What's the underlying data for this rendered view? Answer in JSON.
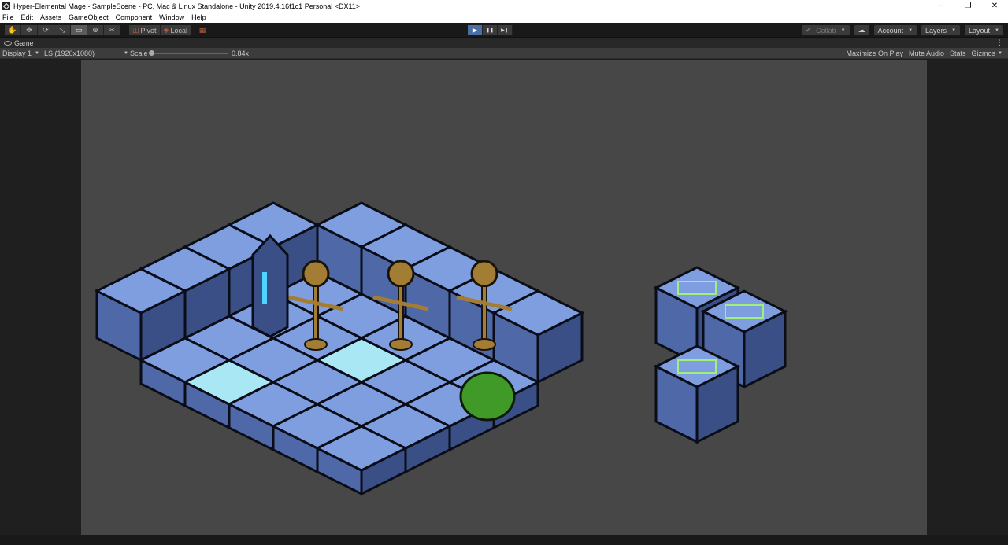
{
  "window": {
    "title": "Hyper-Elemental Mage - SampleScene - PC, Mac & Linux Standalone - Unity 2019.4.16f1c1 Personal <DX11>",
    "controls": [
      "–",
      "❐",
      "✕"
    ]
  },
  "menu": [
    "File",
    "Edit",
    "Assets",
    "GameObject",
    "Component",
    "Window",
    "Help"
  ],
  "toolbar": {
    "tools": [
      {
        "icon": "hand-icon",
        "glyph": "✋"
      },
      {
        "icon": "move-icon",
        "glyph": "✥"
      },
      {
        "icon": "rotate-icon",
        "glyph": "⟳"
      },
      {
        "icon": "scale-icon",
        "glyph": "⤡"
      },
      {
        "icon": "rect-tool-icon",
        "glyph": "▭"
      },
      {
        "icon": "transform-icon",
        "glyph": "⊕"
      },
      {
        "icon": "custom-tool-icon",
        "glyph": "✂"
      }
    ],
    "pivot_label": "Pivot",
    "local_label": "Local",
    "play_glyph": "▶",
    "pause_glyph": "❚❚",
    "step_glyph": "▶❙",
    "collab_label": "Collab",
    "account_label": "Account",
    "layers_label": "Layers",
    "layout_label": "Layout"
  },
  "game_tab": {
    "label": "Game",
    "menu_glyph": "⋮"
  },
  "game_bar": {
    "display_label": "Display 1",
    "resolution_label": "LS (1920x1080)",
    "scale_label": "Scale",
    "scale_value": "0.84x",
    "scale_fraction": 0.02,
    "maximize_label": "Maximize On Play",
    "mute_label": "Mute Audio",
    "stats_label": "Stats",
    "gizmos_label": "Gizmos"
  },
  "colors": {
    "tile_top": "#7f9ee0",
    "tile_left": "#4f68a8",
    "tile_right": "#3a4f86",
    "highlight_tile": "#a9e7f5",
    "skeleton": "#a47d35",
    "slime": "#3f9a28",
    "rune": "#4fd4ff",
    "outline_green": "#9ef07a"
  }
}
